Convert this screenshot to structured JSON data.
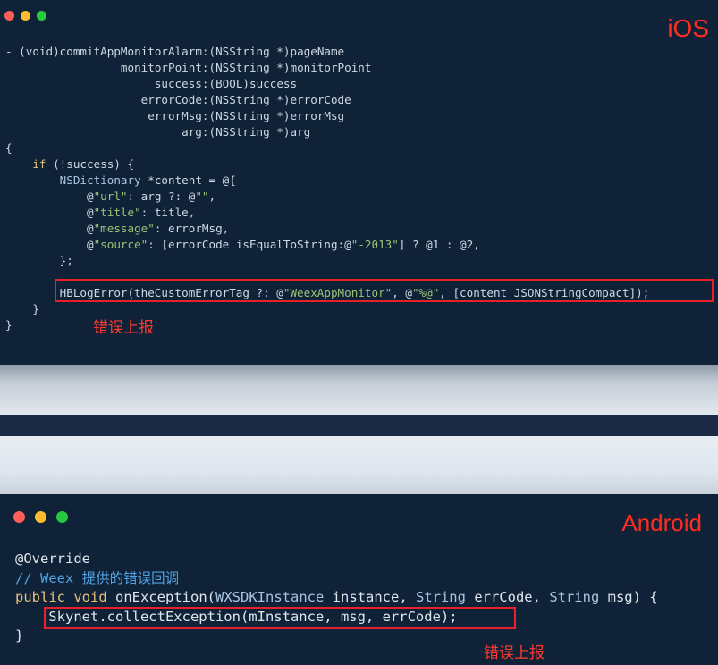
{
  "ios": {
    "platform_label": "iOS",
    "code": {
      "l1_dash": "- ",
      "l1_void": "(void)",
      "l1_sel": "commitAppMonitorAlarm:",
      "l1_type": "(NSString *)",
      "l1_param": "pageName",
      "l2_indent": "                 ",
      "l2_sel": "monitorPoint:",
      "l2_type": "(NSString *)",
      "l2_param": "monitorPoint",
      "l3_indent": "                      ",
      "l3_sel": "success:",
      "l3_type": "(BOOL)",
      "l3_param": "success",
      "l4_indent": "                    ",
      "l4_sel": "errorCode:",
      "l4_type": "(NSString *)",
      "l4_param": "errorCode",
      "l5_indent": "                     ",
      "l5_sel": "errorMsg:",
      "l5_type": "(NSString *)",
      "l5_param": "errorMsg",
      "l6_indent": "                          ",
      "l6_sel": "arg:",
      "l6_type": "(NSString *)",
      "l6_param": "arg",
      "l7": "{",
      "l8_indent": "    ",
      "l8_if": "if",
      "l8_rest": " (!success) {",
      "l9_indent": "        ",
      "l9_type": "NSDictionary",
      "l9_rest": " *content = @{",
      "l10_a": "            @",
      "l10_key": "\"url\"",
      "l10_b": ": arg ?: @",
      "l10_val": "\"\"",
      "l10_c": ",",
      "l11_a": "            @",
      "l11_key": "\"title\"",
      "l11_b": ": title,",
      "l12_a": "            @",
      "l12_key": "\"message\"",
      "l12_b": ": errorMsg,",
      "l13_a": "            @",
      "l13_key": "\"source\"",
      "l13_b": ": [errorCode isEqualToString:@",
      "l13_val": "\"-2013\"",
      "l13_c": "] ? @1 : @2,",
      "l14": "        };",
      "l15": "",
      "l16_a": "        HBLogError(theCustomErrorTag ?: @",
      "l16_s1": "\"WeexAppMonitor\"",
      "l16_b": ", @",
      "l16_s2": "\"%@\"",
      "l16_c": ", [content JSONStringCompact]);",
      "l17": "    }",
      "l18": "}"
    },
    "annotation": "错误上报"
  },
  "android": {
    "platform_label": "Android",
    "code": {
      "l1": "@Override",
      "l2": "// Weex 提供的错误回调",
      "l3_public": "public",
      "l3_sp1": " ",
      "l3_void": "void",
      "l3_a": " onException(",
      "l3_type1": "WXSDKInstance",
      "l3_b": " instance, ",
      "l3_type2": "String",
      "l3_c": " errCode, ",
      "l3_type3": "String",
      "l3_d": " msg) {",
      "l4": "    Skynet.collectException(mInstance, msg, errCode);",
      "l5": "}"
    },
    "annotation": "错误上报"
  }
}
